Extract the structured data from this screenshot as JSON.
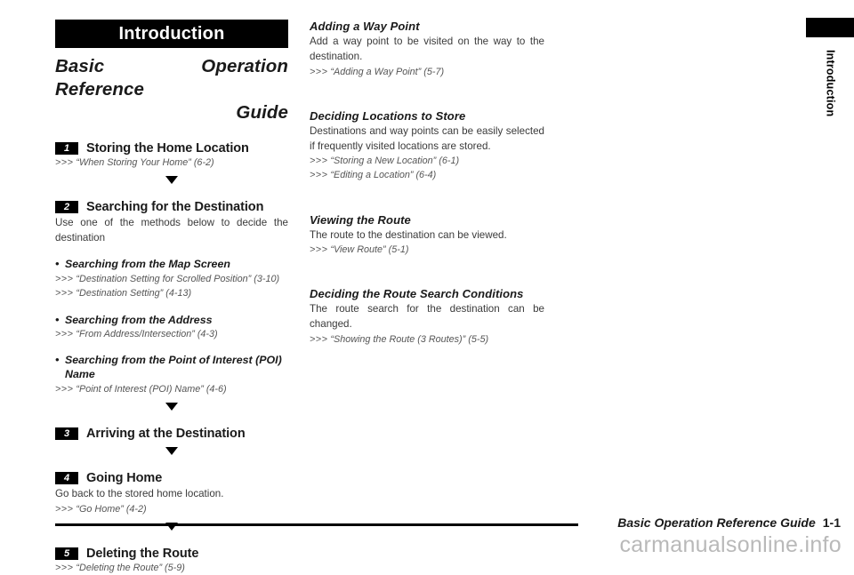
{
  "side_tab": {
    "label": "Introduction"
  },
  "left_column": {
    "banner_title": "Introduction",
    "subtitle_line1": "Basic Operation Reference",
    "subtitle_line2": "Guide",
    "steps": [
      {
        "number": "1",
        "title": "Storing the Home Location",
        "refs": [
          {
            "arrows": ">>>",
            "text": "“When Storing Your Home” (6-2)"
          }
        ]
      },
      {
        "number": "2",
        "title": "Searching for the Destination",
        "body": "Use one of the methods below to decide the destination",
        "bullets": [
          {
            "dot": "•",
            "text": "Searching from the Map Screen",
            "refs": [
              {
                "arrows": ">>>",
                "text": "“Destination Setting for Scrolled Position” (3-10)"
              },
              {
                "arrows": ">>>",
                "text": "“Destination Setting” (4-13)"
              }
            ]
          },
          {
            "dot": "•",
            "text": "Searching from the Address",
            "refs": [
              {
                "arrows": ">>>",
                "text": "“From Address/Intersection” (4-3)"
              }
            ]
          },
          {
            "dot": "•",
            "text": "Searching from the Point of Interest (POI) Name",
            "refs": [
              {
                "arrows": ">>>",
                "text": "“Point of Interest (POI) Name” (4-6)"
              }
            ]
          }
        ]
      },
      {
        "number": "3",
        "title": "Arriving at the Destination",
        "refs": []
      },
      {
        "number": "4",
        "title": "Going Home",
        "body": "Go back to the stored home location.",
        "refs": [
          {
            "arrows": ">>>",
            "text": "“Go Home” (4-2)"
          }
        ]
      },
      {
        "number": "5",
        "title": "Deleting the Route",
        "refs": [
          {
            "arrows": ">>>",
            "text": "“Deleting the Route” (5-9)"
          }
        ]
      }
    ]
  },
  "right_column": {
    "sections": [
      {
        "heading": "Adding a Way Point",
        "body": "Add a way point to be visited on the way to the destination.",
        "refs": [
          {
            "arrows": ">>>",
            "text": "“Adding a Way Point” (5-7)"
          }
        ]
      },
      {
        "heading": "Deciding Locations to Store",
        "body": "Destinations and way points can be easily selected if frequently visited locations are stored.",
        "refs": [
          {
            "arrows": ">>>",
            "text": "“Storing a New Location” (6-1)"
          },
          {
            "arrows": ">>>",
            "text": "“Editing a Location” (6-4)"
          }
        ]
      },
      {
        "heading": "Viewing the Route",
        "body": "The route to the destination can be viewed.",
        "refs": [
          {
            "arrows": ">>>",
            "text": "“View Route” (5-1)"
          }
        ]
      },
      {
        "heading": "Deciding the Route Search Conditions",
        "body": "The route search for the destination can be changed.",
        "refs": [
          {
            "arrows": ">>>",
            "text": "“Showing the Route (3 Routes)” (5-5)"
          }
        ]
      }
    ]
  },
  "footer": {
    "title": "Basic Operation Reference Guide",
    "page_number": "1-1",
    "watermark": "carmanualsonline.info"
  }
}
